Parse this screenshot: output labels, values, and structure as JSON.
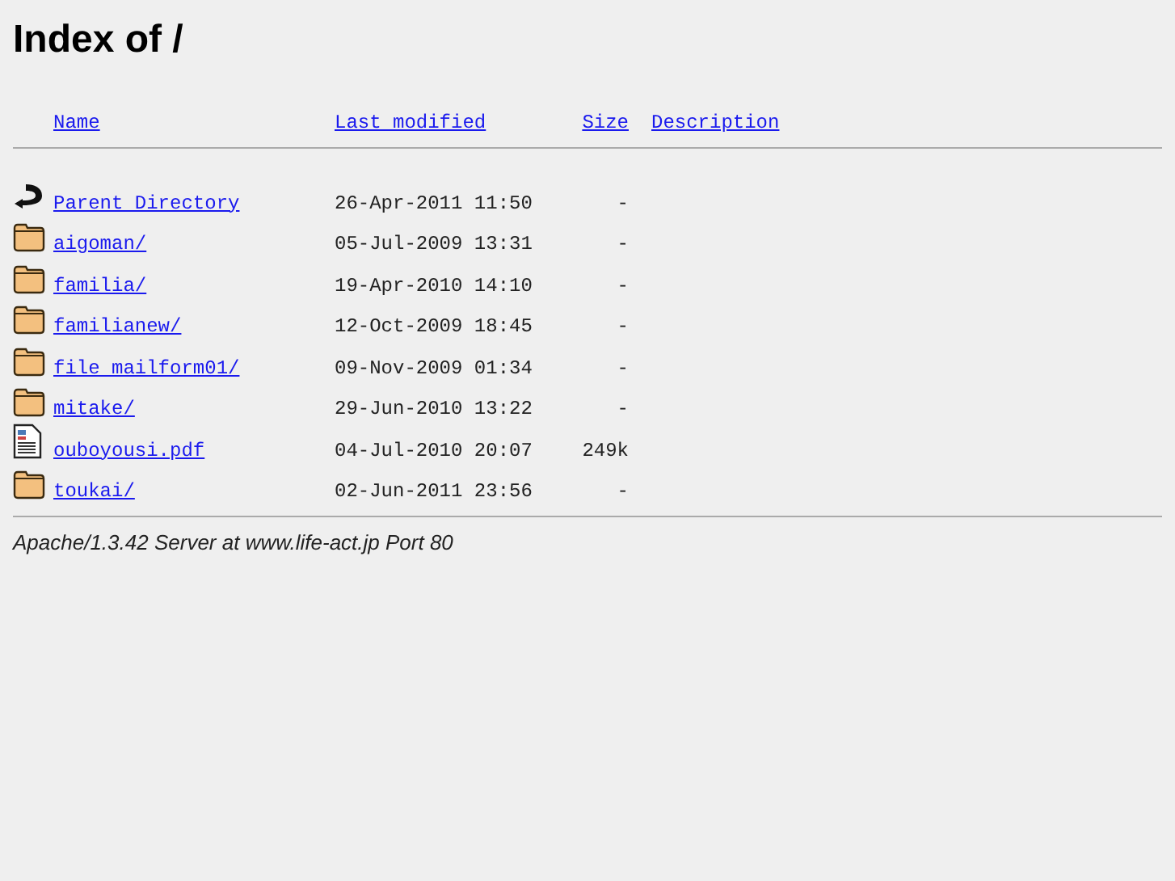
{
  "title": "Index of /",
  "columns": [
    "Name",
    "Last modified",
    "Size",
    "Description"
  ],
  "rows": [
    {
      "kind": "back",
      "name": "Parent Directory",
      "modified": "26-Apr-2011 11:50",
      "size": "-"
    },
    {
      "kind": "folder",
      "name": "aigoman/",
      "modified": "05-Jul-2009 13:31",
      "size": "-"
    },
    {
      "kind": "folder",
      "name": "familia/",
      "modified": "19-Apr-2010 14:10",
      "size": "-"
    },
    {
      "kind": "folder",
      "name": "familianew/",
      "modified": "12-Oct-2009 18:45",
      "size": "-"
    },
    {
      "kind": "folder",
      "name": "file mailform01/",
      "modified": "09-Nov-2009 01:34",
      "size": "-"
    },
    {
      "kind": "folder",
      "name": "mitake/",
      "modified": "29-Jun-2010 13:22",
      "size": "-"
    },
    {
      "kind": "file",
      "name": "ouboyousi.pdf",
      "modified": "04-Jul-2010 20:07",
      "size": "249k"
    },
    {
      "kind": "folder",
      "name": "toukai/",
      "modified": "02-Jun-2011 23:56",
      "size": "-"
    }
  ],
  "footer": "Apache/1.3.42 Server at www.life-act.jp Port 80"
}
